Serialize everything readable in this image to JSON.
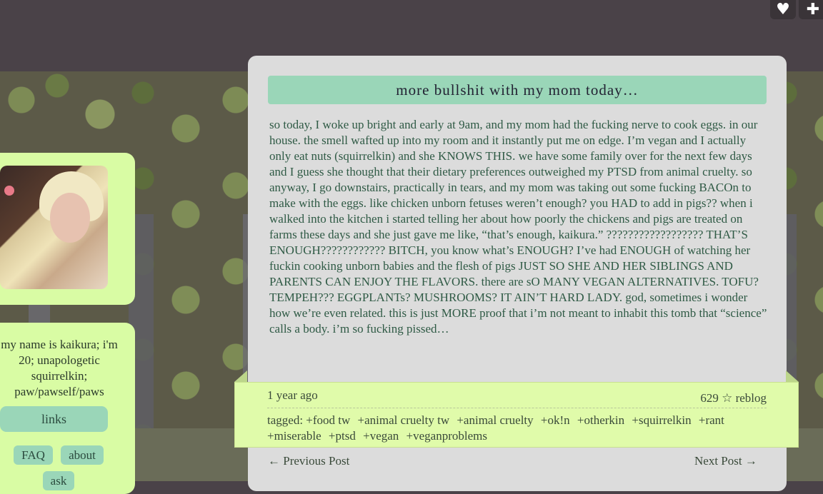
{
  "top_buttons": {
    "like_icon": "heart-icon",
    "follow_icon": "plus-icon"
  },
  "sidebar": {
    "bio": "my name is kaikura; i'm 20; unapologetic squirrelkin; paw/pawself/paws",
    "links_label": "links",
    "faq_label": "FAQ",
    "about_label": "about",
    "ask_label": "ask"
  },
  "post": {
    "title": "more bullshit with my mom today…",
    "body": "so today, I woke up bright and early at 9am, and my mom had the fucking nerve to cook eggs. in our house. the smell wafted up into my room and it instantly put me on edge. I’m vegan and I actually only eat nuts (squirrelkin) and she KNOWS THIS. we have some family over for the next few days and I guess she thought that their dietary preferences outweighed my PTSD from animal cruelty. so anyway, I go downstairs, practically in tears, and my mom was taking out some fucking BACOn to make with the eggs. like chicken unborn fetuses weren’t enough? you HAD to add in pigs?? when i walked into the kitchen i started telling her about how poorly the chickens and pigs are treated on farms these days and she just gave me like, “that’s enough, kaikura.” ?????????????????? THAT’S ENOUGH???????????? BITCH, you know what’s ENOUGH? I’ve had ENOUGH of watching her fuckin cooking unborn babies and the flesh of pigs JUST SO SHE AND HER SIBLINGS AND PARENTS CAN ENJOY THE FLAVORS. there are sO MANY VEGAN ALTERNATIVES. TOFU? TEMPEH??? EGGPLANTs? MUSHROOMS? IT AIN’T HARD LADY. god, sometimes i wonder how we’re even related. this is just MORE proof that i’m not meant to inhabit this tomb that “science” calls a body. i’m so fucking pissed…",
    "time": "1 year ago",
    "notes": "629 ☆ reblog",
    "tags_prefix": "tagged:",
    "tags": [
      "+food tw",
      "+animal cruelty tw",
      "+animal cruelty",
      "+ok!n",
      "+otherkin",
      "+squirrelkin",
      "+rant",
      "+miserable",
      "+ptsd",
      "+vegan",
      "+veganproblems"
    ]
  },
  "nav": {
    "previous": "← Previous Post",
    "next": "Next Post →"
  },
  "colors": {
    "sidebar_bg": "#d9fca4",
    "accent": "#9ad6b8",
    "post_bg": "#dcdcdc",
    "body_text": "#2f5a45"
  }
}
